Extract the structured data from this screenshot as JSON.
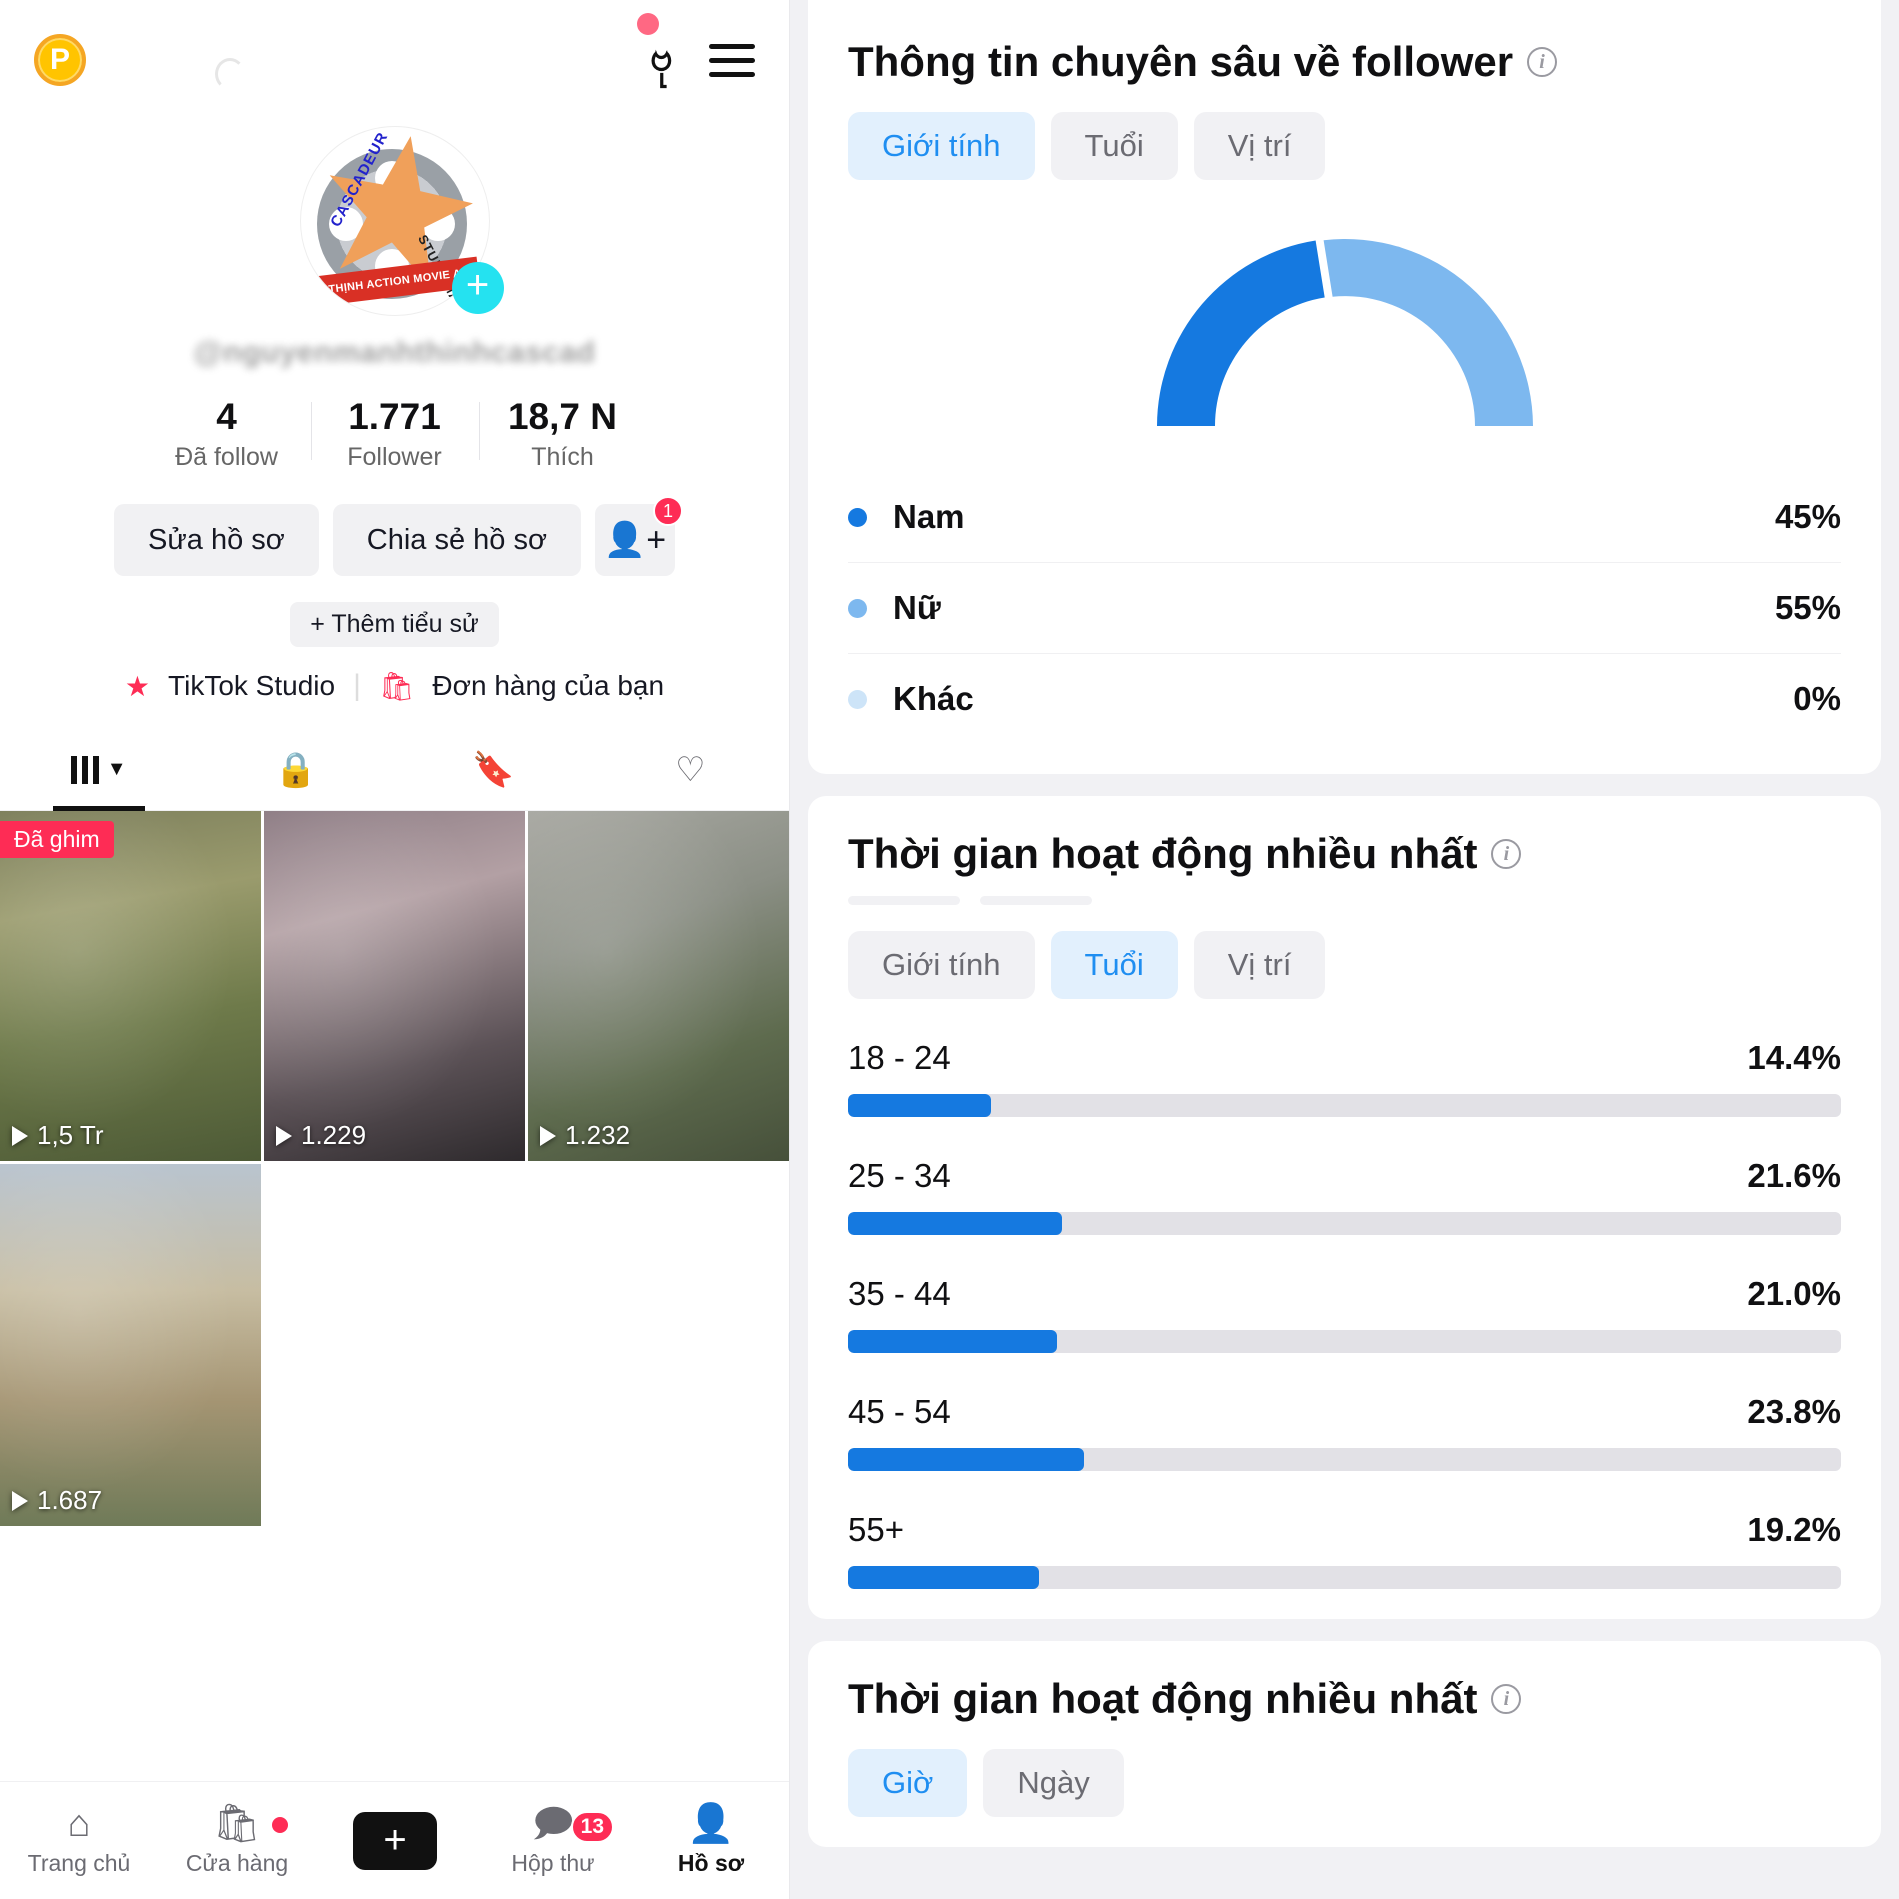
{
  "phone": {
    "header": {
      "coin_label": "P",
      "footprints_icon": "footprints-icon",
      "menu_icon": "hamburger-menu-icon"
    },
    "avatar": {
      "ring_text_left": "CASCADEUR",
      "ring_text_right": "STUNT MAN",
      "banner_text": "C THỊNH ACTION MOVIE AS",
      "add_label": "+"
    },
    "handle": "@nguyenmanhthinhcascad",
    "stats": [
      {
        "value": "4",
        "label": "Đã follow"
      },
      {
        "value": "1.771",
        "label": "Follower"
      },
      {
        "value": "18,7 N",
        "label": "Thích"
      }
    ],
    "actions": {
      "edit_profile": "Sửa hồ sơ",
      "share_profile": "Chia sẻ hồ sơ",
      "add_friend_badge": "1"
    },
    "add_bio": "+ Thêm tiểu sử",
    "studio": {
      "tiktok_studio": "TikTok Studio",
      "orders": "Đơn hàng của bạn"
    },
    "tabs": [
      {
        "name": "videos",
        "icon": "bars-icon",
        "active": true
      },
      {
        "name": "private",
        "icon": "lock-icon",
        "active": false
      },
      {
        "name": "reposts",
        "icon": "repost-off-icon",
        "active": false
      },
      {
        "name": "liked",
        "icon": "heart-icon",
        "active": false
      }
    ],
    "videos": [
      {
        "plays": "1,5 Tr",
        "pinned_label": "Đã ghim"
      },
      {
        "plays": "1.229",
        "pinned_label": ""
      },
      {
        "plays": "1.232",
        "pinned_label": ""
      },
      {
        "plays": "1.687",
        "pinned_label": ""
      }
    ],
    "bottom_nav": [
      {
        "label": "Trang chủ",
        "icon": "home-icon",
        "active": false,
        "badge": ""
      },
      {
        "label": "Cửa hàng",
        "icon": "shop-bag-icon",
        "active": false,
        "badge": "dot"
      },
      {
        "label": "",
        "icon": "create-plus-icon",
        "active": false,
        "badge": ""
      },
      {
        "label": "Hộp thư",
        "icon": "inbox-message-icon",
        "active": false,
        "badge": "13"
      },
      {
        "label": "Hồ sơ",
        "icon": "profile-person-icon",
        "active": true,
        "badge": ""
      }
    ]
  },
  "analytics": {
    "follower_insights": {
      "title": "Thông tin chuyên sâu về follower",
      "info_icon": "info-icon",
      "tabs": [
        {
          "label": "Giới tính",
          "selected": true
        },
        {
          "label": "Tuổi",
          "selected": false
        },
        {
          "label": "Vị trí",
          "selected": false
        }
      ]
    },
    "activity_age": {
      "title": "Thời gian hoạt động nhiều nhất",
      "info_icon": "info-icon",
      "tabs": [
        {
          "label": "Giới tính",
          "selected": false
        },
        {
          "label": "Tuổi",
          "selected": true
        },
        {
          "label": "Vị trí",
          "selected": false
        }
      ]
    },
    "activity_time": {
      "title": "Thời gian hoạt động nhiều nhất",
      "info_icon": "info-icon",
      "tabs": [
        {
          "label": "Giờ",
          "selected": true
        },
        {
          "label": "Ngày",
          "selected": false
        }
      ]
    },
    "colors": {
      "male": "#1579e0",
      "female": "#7db8ef",
      "other": "#cde4f8",
      "bar": "#1579e0",
      "track": "#e2e1e6",
      "accent": "#1f8ef1"
    }
  },
  "chart_data": [
    {
      "type": "pie",
      "title": "Thông tin chuyên sâu về follower",
      "subtype": "semicircular-donut-gauge",
      "categories": [
        "Nam",
        "Nữ",
        "Khác"
      ],
      "values": [
        45,
        55,
        0
      ],
      "labels": [
        "45%",
        "55%",
        "0%"
      ],
      "colors": [
        "#1579e0",
        "#7db8ef",
        "#cde4f8"
      ],
      "legend_position": "below",
      "unit": "%"
    },
    {
      "type": "bar",
      "orientation": "horizontal",
      "title": "Thời gian hoạt động nhiều nhất",
      "categories": [
        "18 - 24",
        "25 - 34",
        "35 - 44",
        "45 - 54",
        "55+"
      ],
      "values": [
        14.4,
        21.6,
        21.0,
        23.8,
        19.2
      ],
      "labels": [
        "14.4%",
        "21.6%",
        "21.0%",
        "23.8%",
        "19.2%"
      ],
      "xlabel": "",
      "ylabel": "",
      "xlim": [
        0,
        100
      ],
      "grid": false,
      "bar_color": "#1579e0",
      "track_color": "#e2e1e6",
      "unit": "%"
    }
  ]
}
